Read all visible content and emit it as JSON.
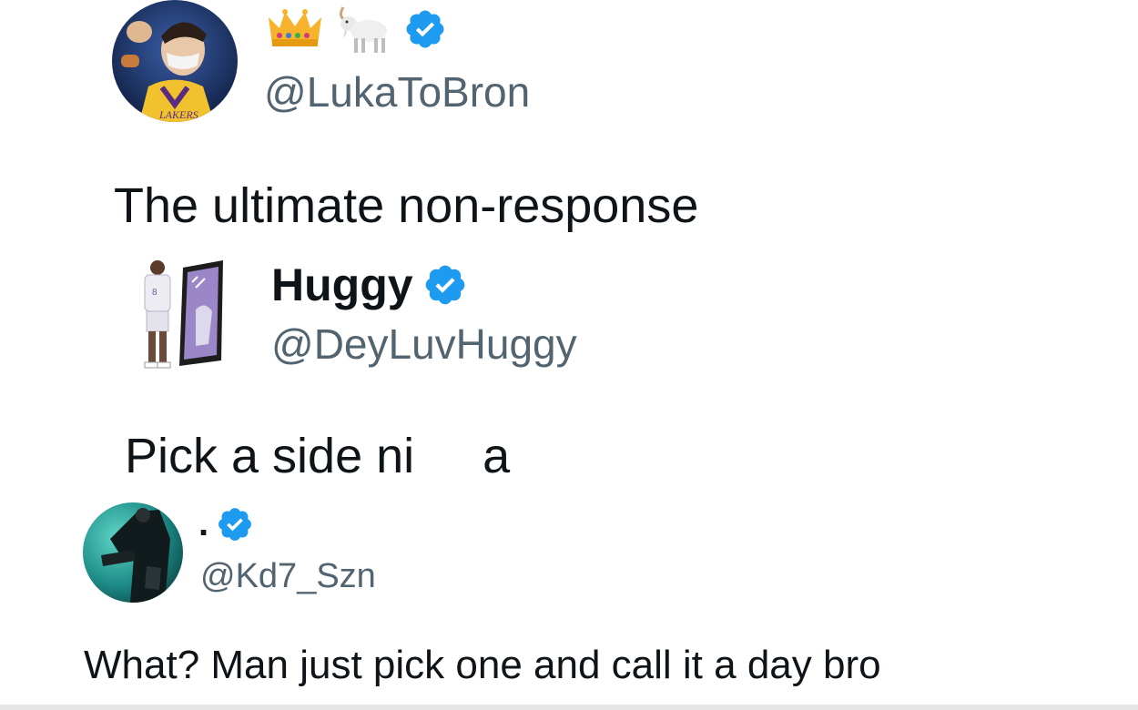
{
  "colors": {
    "text_primary": "#0f1419",
    "text_secondary": "#536471",
    "verified_blue": "#1d9bf0"
  },
  "tweets": [
    {
      "avatar_icon": "avatar-lakers-player-icon",
      "name_icons": [
        "crown-icon",
        "goat-icon",
        "verified-badge-icon"
      ],
      "handle": "@LukaToBron",
      "text": "The ultimate non-response"
    },
    {
      "avatar_icon": "avatar-player-mirror-icon",
      "name": "Huggy",
      "handle": "@DeyLuvHuggy",
      "text": "Pick a side ni     a"
    },
    {
      "avatar_icon": "avatar-teal-figure-icon",
      "name": ".",
      "handle": "@Kd7_Szn",
      "text": "What? Man just pick one and call it a day bro"
    }
  ]
}
